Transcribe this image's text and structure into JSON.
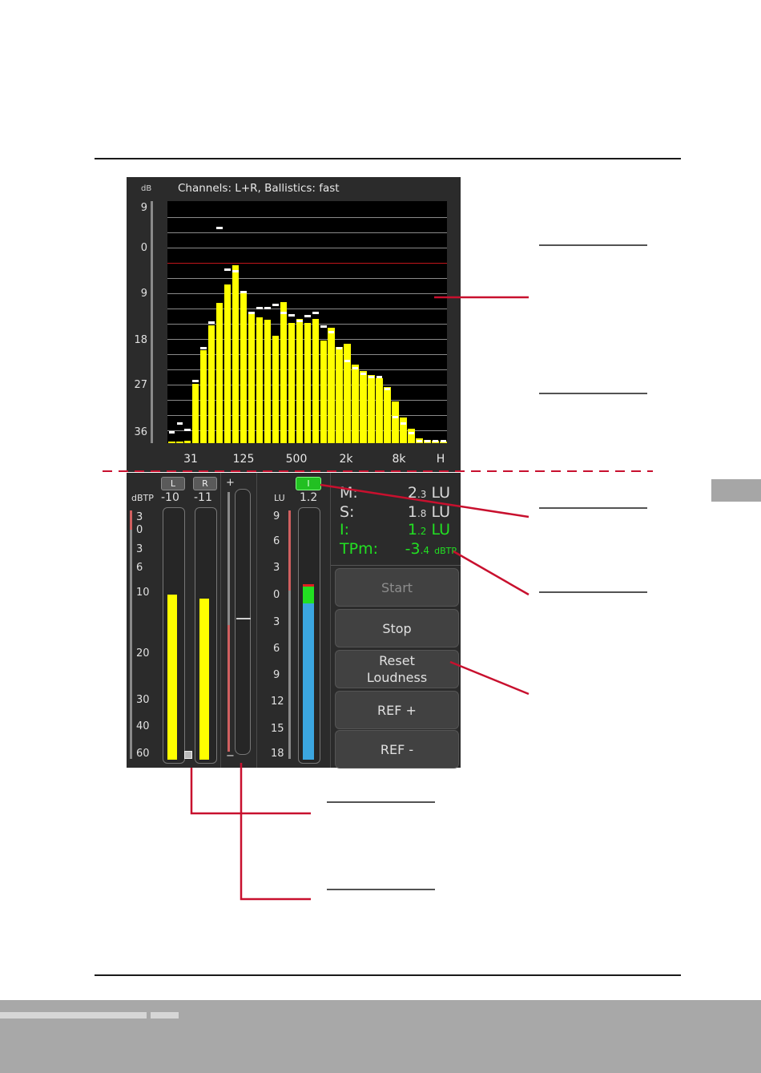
{
  "spectrum": {
    "title": "Channels: L+R, Ballistics: fast",
    "unit": "dB",
    "scale": [
      "9",
      "0",
      "9",
      "18",
      "27",
      "36"
    ],
    "x_labels": [
      "31",
      "125",
      "500",
      "2k",
      "8k",
      "H"
    ]
  },
  "meters": {
    "peak": {
      "unit": "dBTP",
      "channels": [
        {
          "label": "L",
          "value": "-10"
        },
        {
          "label": "R",
          "value": "-11"
        }
      ],
      "scale": [
        "3",
        "0",
        "3",
        "6",
        "10",
        "20",
        "30",
        "40",
        "60"
      ]
    },
    "fader": {
      "plus": "+",
      "minus": "−"
    },
    "loudness": {
      "unit": "LU",
      "value": "1.2",
      "indicator": "I",
      "scale": [
        "9",
        "6",
        "3",
        "0",
        "3",
        "6",
        "9",
        "12",
        "15",
        "18"
      ]
    }
  },
  "readouts": {
    "m": {
      "label": "M:",
      "int": "2",
      "dec": ".3",
      "unit": "LU"
    },
    "s": {
      "label": "S:",
      "int": "1",
      "dec": ".8",
      "unit": "LU"
    },
    "i": {
      "label": "I:",
      "int": "1",
      "dec": ".2",
      "unit": "LU"
    },
    "tp": {
      "label": "TPm:",
      "int": "-3",
      "dec": ".4",
      "unit": "dBTP"
    }
  },
  "buttons": {
    "start": "Start",
    "stop": "Stop",
    "reset_line1": "Reset",
    "reset_line2": "Loudness",
    "ref_plus": "REF +",
    "ref_minus": "REF -"
  },
  "colors": {
    "bar": "#ffff00",
    "peak": "#ffffff",
    "ref_line": "#c0141a",
    "callout": "#c8102e",
    "loudness_green": "#22e022",
    "loudness_blue": "#3ba6e0"
  }
}
